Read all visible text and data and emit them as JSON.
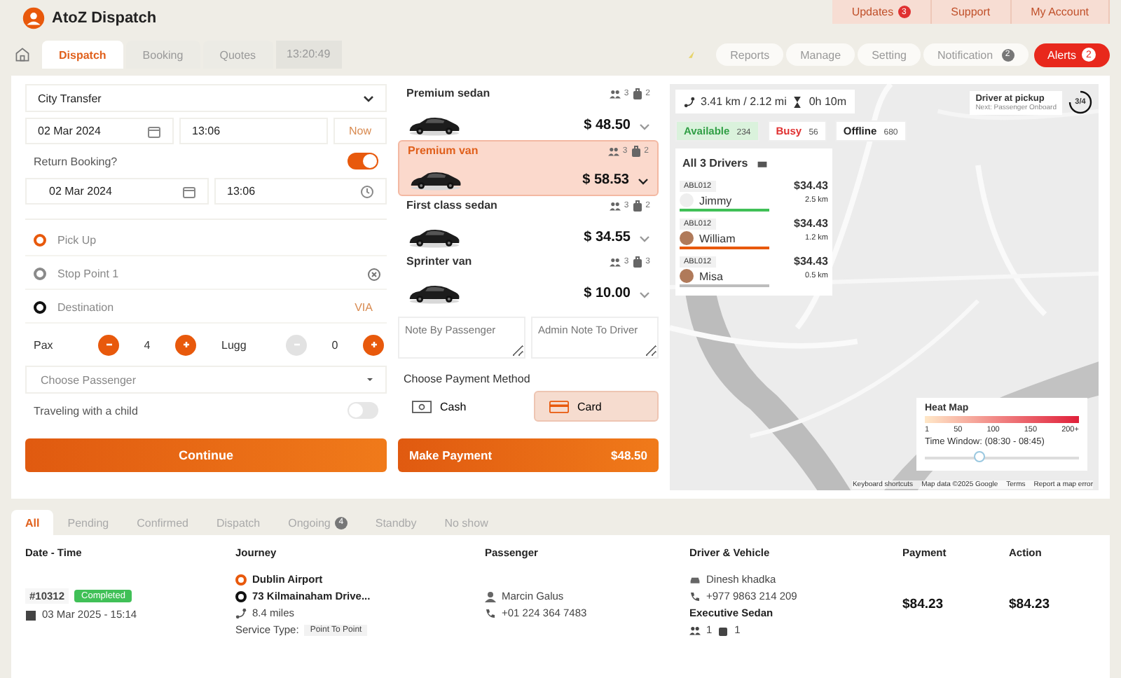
{
  "app": {
    "title": "AtoZ Dispatch"
  },
  "top_links": [
    {
      "label": "Updates",
      "badge": "3"
    },
    {
      "label": "Support"
    },
    {
      "label": "My Account"
    }
  ],
  "tabs": [
    {
      "label": "Dispatch",
      "selected": true
    },
    {
      "label": "Booking",
      "selected": false
    },
    {
      "label": "Quotes",
      "selected": false
    }
  ],
  "clock": "13:20:49",
  "nav": [
    {
      "label": "Reports",
      "kind": "link"
    },
    {
      "label": "Manage",
      "kind": "link"
    },
    {
      "label": "Setting",
      "kind": "link"
    },
    {
      "label": "Notification",
      "badge": "2",
      "kind": "link"
    },
    {
      "label": "Alerts",
      "badge": "2",
      "kind": "alert"
    }
  ],
  "booking": {
    "service": "City Transfer",
    "date": "02 Mar 2024",
    "time": "13:06",
    "now": "Now",
    "return_label": "Return Booking?",
    "return_on": true,
    "return_date": "02 Mar 2024",
    "return_time": "13:06",
    "locations": [
      {
        "placeholder": "Pick Up",
        "color": "#e8590c",
        "removable": false
      },
      {
        "placeholder": "Stop Point 1",
        "color": "#8a8a8a",
        "removable": true
      },
      {
        "placeholder": "Destination",
        "color": "#111111",
        "removable": false,
        "link": "VIA"
      }
    ],
    "counters": [
      {
        "label": "Pax",
        "value": "4",
        "minus_disabled": false
      },
      {
        "label": "Lugg",
        "value": "0",
        "minus_disabled": true
      }
    ],
    "passenger_placeholder": "Choose Passenger",
    "child_label": "Traveling with a child",
    "child_on": false,
    "continue": "Continue"
  },
  "vehicles": [
    {
      "name": "Premium sedan",
      "pax": "3",
      "bags": "2",
      "price": "$ 48.50",
      "selected": false
    },
    {
      "name": "Premium van",
      "pax": "3",
      "bags": "2",
      "price": "$ 58.53",
      "selected": true
    },
    {
      "name": "First class sedan",
      "pax": "3",
      "bags": "2",
      "price": "$ 34.55",
      "selected": false
    },
    {
      "name": "Sprinter van",
      "pax": "3",
      "bags": "3",
      "price": "$ 10.00",
      "selected": false
    }
  ],
  "notes": [
    {
      "placeholder": "Note By Passenger"
    },
    {
      "placeholder": "Admin Note To Driver"
    }
  ],
  "payment": {
    "label": "Choose Payment Method",
    "methods": [
      {
        "label": "Cash",
        "kind": "cash",
        "selected": false
      },
      {
        "label": "Card",
        "kind": "card",
        "selected": true
      }
    ],
    "button": "Make Payment",
    "amount": "$48.50"
  },
  "map": {
    "distance": "3.41 km / 2.12 mi",
    "duration": "0h 10m",
    "statuses": [
      {
        "label": "Available",
        "count": "234",
        "color": "#2f9e44",
        "selected": true
      },
      {
        "label": "Busy",
        "count": "56",
        "color": "#e03131",
        "selected": false
      },
      {
        "label": "Offline",
        "count": "680",
        "color": "#222222",
        "selected": false
      }
    ],
    "drivers_title": "All 3 Drivers",
    "drivers": [
      {
        "plate": "ABL012",
        "price": "$34.43",
        "name": "Jimmy",
        "distance": "2.5 km",
        "color": "#40c057",
        "avatar": false
      },
      {
        "plate": "ABL012",
        "price": "$34.43",
        "name": "William",
        "distance": "1.2 km",
        "color": "#e8590c",
        "avatar": true
      },
      {
        "plate": "ABL012",
        "price": "$34.43",
        "name": "Misa",
        "distance": "0.5 km",
        "color": "#bdbdbd",
        "avatar": true
      }
    ],
    "pickup": {
      "title": "Driver at pickup",
      "subtitle": "Next: Passenger Onboard",
      "progress": "3/4"
    },
    "heatmap": {
      "title": "Heat Map",
      "scale": [
        "1",
        "50",
        "100",
        "150",
        "200+"
      ],
      "time_window": "Time Window: (08:30 - 08:45)",
      "level": 0.35
    },
    "attribution": [
      "Keyboard shortcuts",
      "Map data ©2025 Google",
      "Terms",
      "Report a map error"
    ]
  },
  "bookings": {
    "tabs": [
      {
        "label": "All",
        "selected": true
      },
      {
        "label": "Pending",
        "selected": false
      },
      {
        "label": "Confirmed",
        "selected": false
      },
      {
        "label": "Dispatch",
        "selected": false
      },
      {
        "label": "Ongoing",
        "badge": "4",
        "selected": false
      },
      {
        "label": "Standby",
        "selected": false
      },
      {
        "label": "No show",
        "selected": false
      }
    ],
    "columns": [
      "Date - Time",
      "Journey",
      "Passenger",
      "Driver & Vehicle",
      "Payment",
      "Action"
    ],
    "rows": [
      {
        "id": "#10312",
        "status": "Completed",
        "color": "#40c057",
        "datetime": "03 Mar 2025 - 15:14",
        "from": "Dublin Airport",
        "to": "73 Kilmainaham Drive...",
        "distance": "8.4 miles",
        "service_label": "Service Type:",
        "service": "Point To Point",
        "passenger": "Marcin Galus",
        "passenger_phone": "+01 224 364 7483",
        "driver": "Dinesh khadka",
        "driver_phone": "+977 9863 214 209",
        "vehicle": "Executive Sedan",
        "pax": "1",
        "bags": "1",
        "payment": "$84.23",
        "action": "$84.23"
      }
    ]
  }
}
